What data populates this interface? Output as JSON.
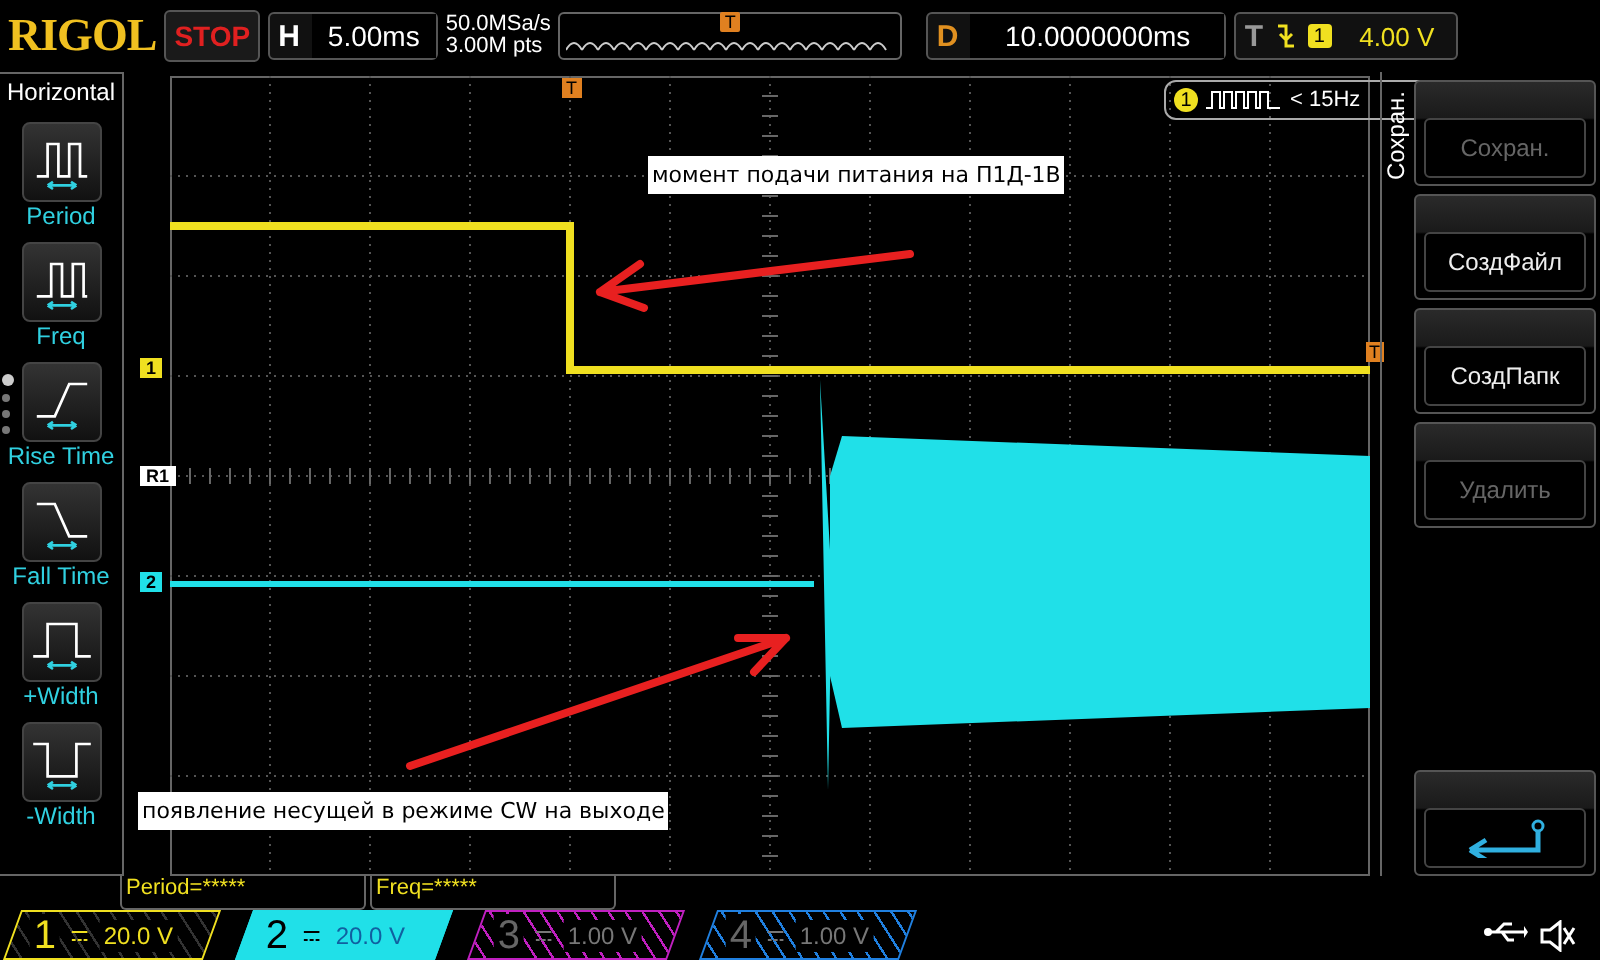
{
  "header": {
    "logo": "RIGOL",
    "run_state": "STOP",
    "horizontal": {
      "label": "H",
      "value": "5.00ms"
    },
    "sample_rate": "50.0MSa/s",
    "memory_depth": "3.00M pts",
    "memory_trigger_marker": "T",
    "delay": {
      "label": "D",
      "value": "10.0000000ms"
    },
    "trigger": {
      "label": "T",
      "source": "1",
      "level": "4.00 V"
    }
  },
  "left_menu": {
    "title": "Horizontal",
    "items": [
      {
        "kind": "period",
        "label": "Period"
      },
      {
        "kind": "freq",
        "label": "Freq"
      },
      {
        "kind": "rise",
        "label": "Rise Time"
      },
      {
        "kind": "fall",
        "label": "Fall Time"
      },
      {
        "kind": "pwidth",
        "label": "+Width"
      },
      {
        "kind": "nwidth",
        "label": "-Width"
      }
    ],
    "pages": [
      {
        "selected": true
      },
      {
        "selected": false
      },
      {
        "selected": false
      },
      {
        "selected": false
      }
    ]
  },
  "plot": {
    "markers": [
      {
        "label": "1",
        "color": "#f0e020"
      },
      {
        "label": "R1",
        "color": "#ffffff"
      },
      {
        "label": "2",
        "color": "#20e0e8"
      }
    ],
    "trigger_top": "T",
    "trigger_right": "T",
    "frequency_badge": {
      "source": "1",
      "text": "< 15Hz"
    },
    "annotations": [
      {
        "text": "момент подачи питания на П1Д-1В"
      },
      {
        "text": "появление несущей в режиме CW на выходе"
      }
    ]
  },
  "measurements": [
    "Period=*****",
    "Freq=*****"
  ],
  "right_menu": {
    "title": "Сохран.",
    "buttons": [
      {
        "kind": "text",
        "label": "Сохран.",
        "disabled": true
      },
      {
        "kind": "text",
        "label": "СоздФайл",
        "disabled": false
      },
      {
        "kind": "text",
        "label": "СоздПапк",
        "disabled": false
      },
      {
        "kind": "text",
        "label": "Удалить",
        "disabled": true
      },
      {
        "kind": "empty"
      },
      {
        "kind": "back"
      }
    ]
  },
  "channels": [
    {
      "label": "1",
      "scale": "20.0 V",
      "selected": false,
      "on": true,
      "color": "#f0e020"
    },
    {
      "label": "2",
      "scale": "20.0 V",
      "selected": true,
      "on": true,
      "color": "#20e0e8"
    },
    {
      "label": "3",
      "scale": "1.00 V",
      "selected": false,
      "on": false,
      "color": "#c020c0"
    },
    {
      "label": "4",
      "scale": "1.00 V",
      "selected": false,
      "on": false,
      "color": "#2080e0"
    }
  ]
}
